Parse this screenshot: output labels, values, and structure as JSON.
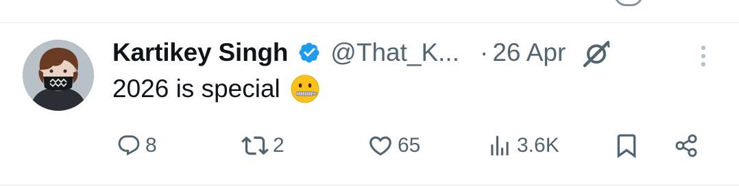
{
  "tweet": {
    "author": {
      "name": "Kartikey Singh",
      "handle": "@That_K...",
      "verified": true
    },
    "separator": "·",
    "date": "26 Apr",
    "text": "2026 is special",
    "emoji": "zipper-mouth-face",
    "stats": {
      "replies": "8",
      "reposts": "2",
      "likes": "65",
      "views": "3.6K"
    }
  },
  "colors": {
    "text": "#0f1419",
    "secondary": "#536471",
    "verified_badge": "#1d9bf0",
    "divider": "#eff3f4"
  },
  "icons": [
    "verified-badge-icon",
    "grok-icon",
    "more-icon",
    "reply-icon",
    "repost-icon",
    "like-icon",
    "views-icon",
    "bookmark-icon",
    "share-icon"
  ]
}
